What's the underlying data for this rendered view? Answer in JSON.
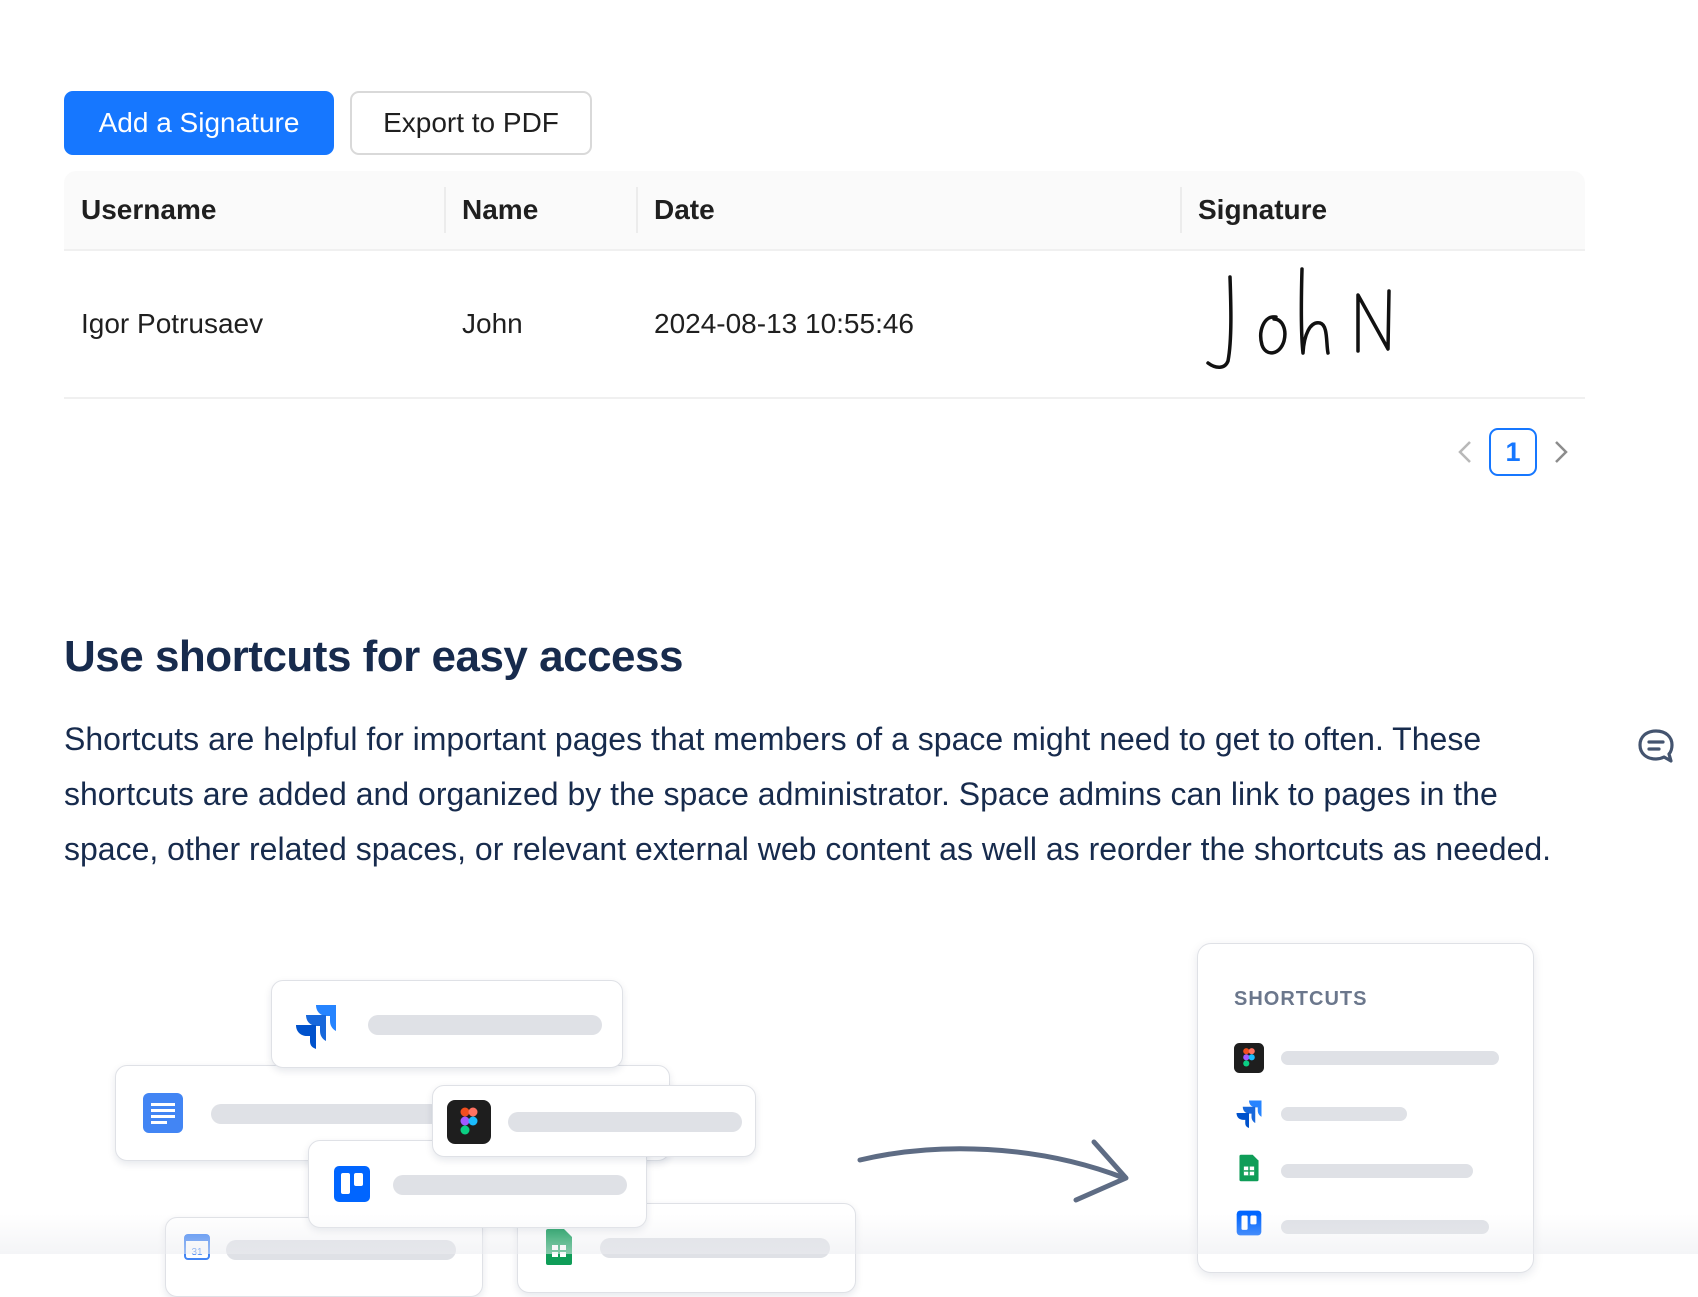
{
  "toolbar": {
    "add_signature_label": "Add a Signature",
    "export_pdf_label": "Export to PDF"
  },
  "table": {
    "columns": [
      "Username",
      "Name",
      "Date",
      "Signature"
    ],
    "rows": [
      {
        "username": "Igor Potrusaev",
        "name": "John",
        "date": "2024-08-13 10:55:46",
        "signature": "JohN"
      }
    ]
  },
  "pagination": {
    "current_page": "1"
  },
  "article": {
    "heading": "Use shortcuts for easy access",
    "paragraph": "Shortcuts are helpful for important pages that members of a space might need to get to often. These shortcuts are added and organized by the space administrator. Space admins can link to pages in the space, other related spaces, or relevant external web content as well as reorder the shortcuts as needed."
  },
  "illustration": {
    "shortcuts_title": "SHORTCUTS",
    "app_icons": [
      "jira-icon",
      "google-docs-icon",
      "figma-icon",
      "trello-icon",
      "google-calendar-icon",
      "google-sheets-icon"
    ],
    "calendar_day": "31"
  },
  "colors": {
    "primary": "#1677ff",
    "heading_text": "#172b4d",
    "jira_blue": "#2684ff",
    "docs_blue": "#4285f4",
    "trello_blue": "#0065ff",
    "sheets_green": "#0f9d58"
  }
}
